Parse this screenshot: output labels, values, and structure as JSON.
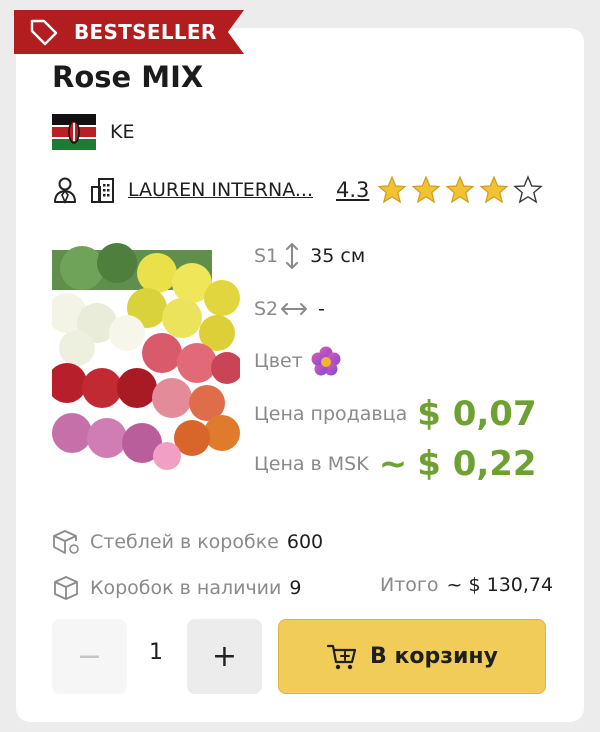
{
  "badge": {
    "label": "BESTSELLER",
    "icon": "tag-icon",
    "color": "#b21e20"
  },
  "product": {
    "title": "Rose MIX",
    "country_code": "KE",
    "flag": "kenya-flag",
    "seller_name": "LAUREN INTERNA...",
    "rating": "4.3",
    "stars": {
      "filled": 4,
      "total": 5,
      "value": 4.3,
      "color": "#f1c232"
    }
  },
  "specs": {
    "s1_label": "S1",
    "s1_value": "35 см",
    "s2_label": "S2",
    "s2_value": "-",
    "color_label": "Цвет",
    "color_icon": "flower-icon",
    "seller_price_label": "Цена продавца",
    "seller_price": "$ 0,07",
    "msk_price_label": "Цена в MSK",
    "msk_prefix": "~",
    "msk_price": "$ 0,22",
    "price_color": "#6fa132"
  },
  "box": {
    "stems_label": "Стеблей в коробке",
    "stems_value": "600",
    "boxes_label": "Коробок в наличии",
    "boxes_value": "9",
    "total_label": "Итого",
    "total_value": "~ $ 130,74"
  },
  "cart": {
    "minus": "−",
    "quantity": "1",
    "plus": "+",
    "button_label": "В корзину",
    "button_color": "#f2cc59"
  }
}
